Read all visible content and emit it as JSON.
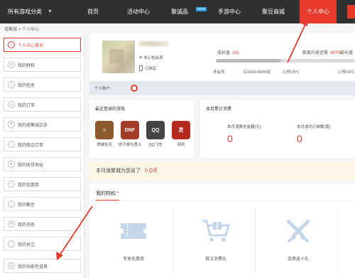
{
  "nav": {
    "category": "所有游戏分类",
    "items": [
      "首页",
      "活动中心",
      "聚诚品",
      "手游中心",
      "聚豆商城",
      "个人中心"
    ],
    "new_badge": "NEW"
  },
  "breadcrumb": "道聚城 > 个人中心",
  "sidebar": {
    "items": [
      {
        "label": "个人中心首页",
        "icon": "home-icon"
      },
      {
        "label": "我的特权",
        "icon": "crown-icon"
      },
      {
        "label": "我的任务",
        "icon": "task-icon"
      },
      {
        "label": "我的订单",
        "icon": "order-icon"
      },
      {
        "label": "我的道聚城白条",
        "icon": "credit-icon"
      },
      {
        "label": "我的周边订单",
        "icon": "package-icon"
      },
      {
        "label": "我的收货地址",
        "icon": "location-icon"
      },
      {
        "label": "我的优惠券",
        "icon": "coupon-icon"
      },
      {
        "label": "我的聚豆",
        "icon": "bean-icon"
      },
      {
        "label": "我的消息",
        "icon": "message-icon"
      },
      {
        "label": "我的关注",
        "icon": "heart-icon"
      },
      {
        "label": "我的功能性道具",
        "icon": "tool-icon"
      }
    ]
  },
  "profile": {
    "member": "非心悦会员",
    "bound": "已绑定",
    "growth_label": "成长值",
    "growth_value": "291",
    "upgrade_label": "距离升级还需",
    "upgrade_value": "49709",
    "growth2_label": "成长值",
    "levels": [
      "非会员",
      "【10000-49999】",
      "心悦VIP1",
      "心悦VIP1"
    ],
    "level_progress": 0.47,
    "account_label": "个人账户:"
  },
  "recent_games": {
    "title": "最近登录的游戏",
    "games": [
      {
        "name": "领域在天",
        "color": "#8b5a2b"
      },
      {
        "name": "地下城与勇士",
        "color": "#a33d2a"
      },
      {
        "name": "QQ飞车",
        "color": "#444444"
      },
      {
        "name": "刻灵",
        "color": "#b52a1f"
      }
    ]
  },
  "monthly": {
    "title": "本月累计消费",
    "total_label": "本月消费总金额(元)",
    "total_value": "0",
    "orders_label": "本月成功订单数(笔)",
    "orders_value": "0"
  },
  "savings": {
    "label": "本月道聚城为您省了:",
    "value": "0 Q币"
  },
  "privileges": {
    "title": "我的特权",
    "star": "*",
    "cards": [
      {
        "label": "专享优惠券",
        "icon": "ticket-icon"
      },
      {
        "label": "首次消费礼",
        "icon": "cart-gift-icon"
      },
      {
        "label": "道具返十礼",
        "icon": "crossed-swords-icon"
      }
    ]
  },
  "colors": {
    "accent": "#e8392d",
    "nav_bg": "#2f3131"
  }
}
